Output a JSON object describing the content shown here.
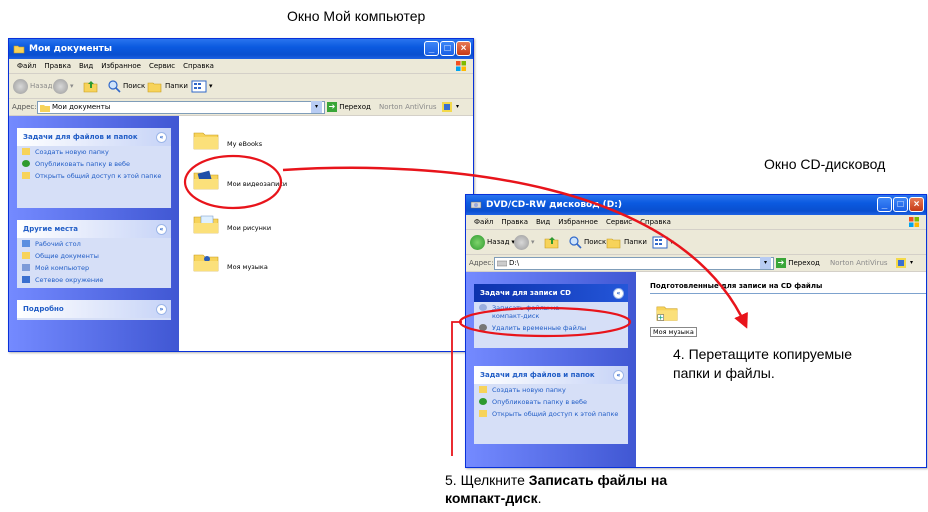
{
  "captions": {
    "my_computer": "Окно Мой компьютер",
    "cd_drive": "Окно CD-дисковод",
    "step4_line1": "4. Перетащите копируемые",
    "step4_line2": "папки и файлы.",
    "step5_prefix": "5. Щелкните ",
    "step5_bold1": "Записать файлы на",
    "step5_bold2": "компакт-диск",
    "step5_suffix": "."
  },
  "win1": {
    "title": "Мои документы",
    "menu": [
      "Файл",
      "Правка",
      "Вид",
      "Избранное",
      "Сервис",
      "Справка"
    ],
    "toolbar": {
      "back": "Назад",
      "search": "Поиск",
      "folders": "Папки"
    },
    "address_label": "Адрес:",
    "address": "Мои документы",
    "go": "Переход",
    "norton": "Norton AntiVirus",
    "tasks_header": "Задачи для файлов и папок",
    "tasks": [
      "Создать новую папку",
      "Опубликовать папку в вебе",
      "Открыть общий доступ к этой папке"
    ],
    "places_header": "Другие места",
    "places": [
      "Рабочий стол",
      "Общие документы",
      "Мой компьютер",
      "Сетевое окружение"
    ],
    "details_header": "Подробно",
    "folders": [
      "My eBooks",
      "Мои видеозаписи",
      "Мои рисунки",
      "Моя музыка"
    ]
  },
  "win2": {
    "title": "DVD/CD-RW дисковод (D:)",
    "menu": [
      "Файл",
      "Правка",
      "Вид",
      "Избранное",
      "Сервис",
      "Справка"
    ],
    "toolbar": {
      "back": "Назад",
      "search": "Поиск",
      "folders": "Папки"
    },
    "address_label": "Адрес:",
    "address": "D:\\",
    "go": "Переход",
    "norton": "Norton AntiVirus",
    "cd_header": "Задачи для записи CD",
    "cd_tasks": [
      "Записать файлы на компакт-диск",
      "Удалить временные файлы"
    ],
    "tasks_header": "Задачи для файлов и папок",
    "tasks": [
      "Создать новую папку",
      "Опубликовать папку в вебе",
      "Открыть общий доступ к этой папке"
    ],
    "content_header": "Подготовленные для записи на CD файлы",
    "item": "Моя музыка"
  },
  "colors": {
    "xp_blue": "#0a4fcf",
    "annotation_red": "#e8141b",
    "link_blue": "#215dc6"
  }
}
